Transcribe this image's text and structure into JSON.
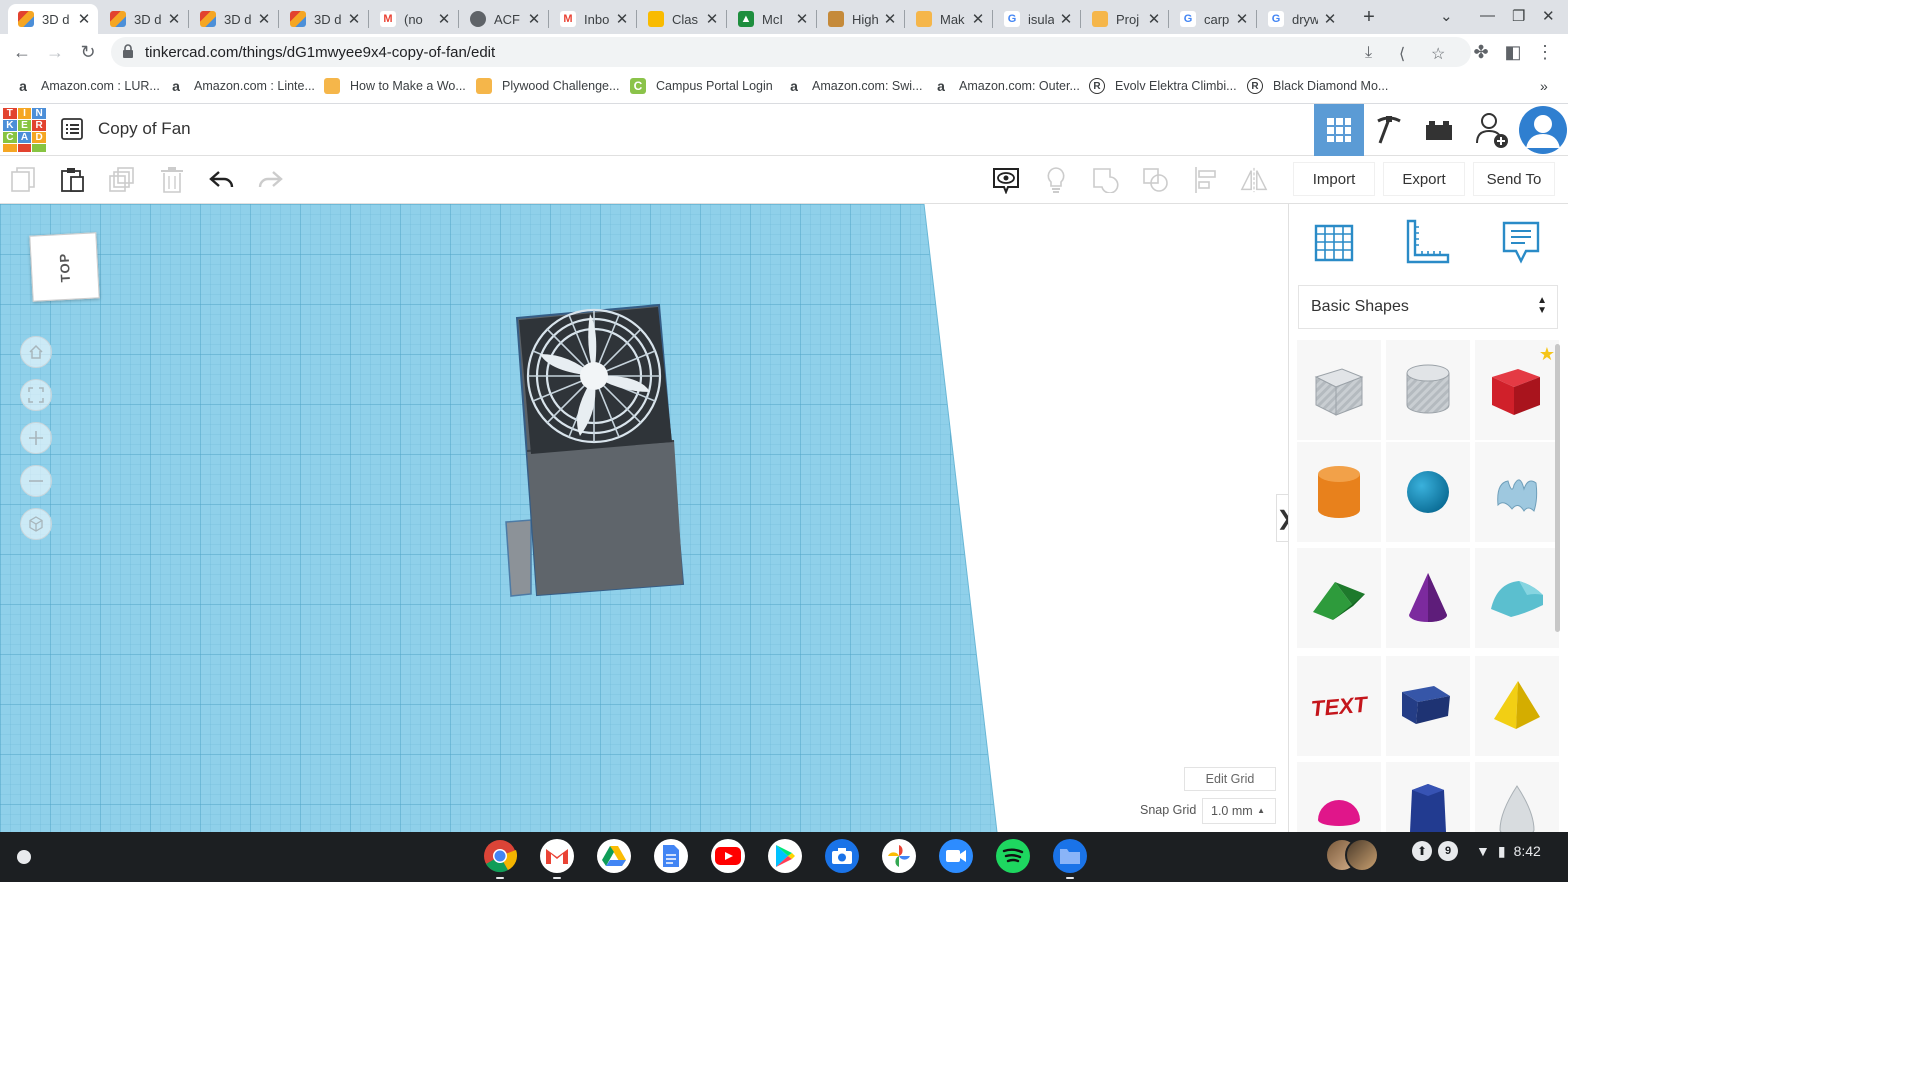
{
  "browser": {
    "tabs": [
      {
        "title": "3D d",
        "icon": "tinkercad-icon",
        "active": true
      },
      {
        "title": "3D d",
        "icon": "tinkercad-icon"
      },
      {
        "title": "3D d",
        "icon": "tinkercad-icon"
      },
      {
        "title": "3D d",
        "icon": "tinkercad-icon"
      },
      {
        "title": "(no",
        "icon": "gmail-icon"
      },
      {
        "title": "ACF",
        "icon": "globe-icon"
      },
      {
        "title": "Inbo",
        "icon": "gmail-icon"
      },
      {
        "title": "Clas",
        "icon": "classroom-icon"
      },
      {
        "title": "McI",
        "icon": "mci-icon"
      },
      {
        "title": "High",
        "icon": "hat-icon"
      },
      {
        "title": "Mak",
        "icon": "hat-icon"
      },
      {
        "title": "isula",
        "icon": "google-icon"
      },
      {
        "title": "Proj",
        "icon": "hat-icon"
      },
      {
        "title": "carp",
        "icon": "google-icon"
      },
      {
        "title": "dryw",
        "icon": "google-icon"
      }
    ],
    "url": "tinkercad.com/things/dG1mwyee9x4-copy-of-fan/edit",
    "bookmarks": [
      {
        "label": "Amazon.com : LUR...",
        "icon": "amazon-icon"
      },
      {
        "label": "Amazon.com : Linte...",
        "icon": "amazon-icon"
      },
      {
        "label": "How to Make a Wo...",
        "icon": "hat-icon"
      },
      {
        "label": "Plywood Challenge...",
        "icon": "hat-icon"
      },
      {
        "label": "Campus Portal Login",
        "icon": "campus-icon"
      },
      {
        "label": "Amazon.com: Swi...",
        "icon": "amazon-icon"
      },
      {
        "label": "Amazon.com: Outer...",
        "icon": "amazon-icon"
      },
      {
        "label": "Evolv Elektra Climbi...",
        "icon": "registered-icon"
      },
      {
        "label": "Black Diamond Mo...",
        "icon": "registered-icon"
      }
    ],
    "more_bookmarks": "»"
  },
  "tinkercad": {
    "logo_letters": [
      "T",
      "I",
      "N",
      "K",
      "E",
      "R",
      "C",
      "A",
      "D"
    ],
    "logo_colors": [
      "#e2432f",
      "#f5a623",
      "#4c8fd8",
      "#4c8fd8",
      "#87c441",
      "#e2432f",
      "#87c441",
      "#4c8fd8",
      "#f5a623",
      "#f5a623",
      "#e2432f",
      "#87c441"
    ],
    "design_title": "Copy of Fan",
    "actions": {
      "import": "Import",
      "export": "Export",
      "send_to": "Send To"
    },
    "viewcube_label": "TOP",
    "edit_grid": "Edit Grid",
    "snap_grid_label": "Snap Grid",
    "snap_grid_value": "1.0 mm",
    "panel_toggle": "❯",
    "shape_category": "Basic Shapes",
    "shapes": [
      "Box Hole",
      "Cylinder Hole",
      "Box",
      "Cylinder",
      "Sphere",
      "Scribble",
      "Roof",
      "Cone",
      "Round Roof",
      "Text",
      "Wedge",
      "Pyramid",
      "Half Sphere",
      "Polygon",
      "Paraboloid"
    ]
  },
  "shelf": {
    "apps": [
      "Chrome",
      "Gmail",
      "Drive",
      "Docs",
      "YouTube",
      "Play Store",
      "Camera",
      "Photos",
      "Zoom",
      "Spotify",
      "Files"
    ],
    "notification_count": "9",
    "time": "8:42"
  },
  "colors": {
    "workplane": "#8fd0ea",
    "accent": "#5b9bd5",
    "box_red": "#d0202a",
    "cylinder_orange": "#e8811c",
    "sphere_blue": "#1a8ab8"
  }
}
